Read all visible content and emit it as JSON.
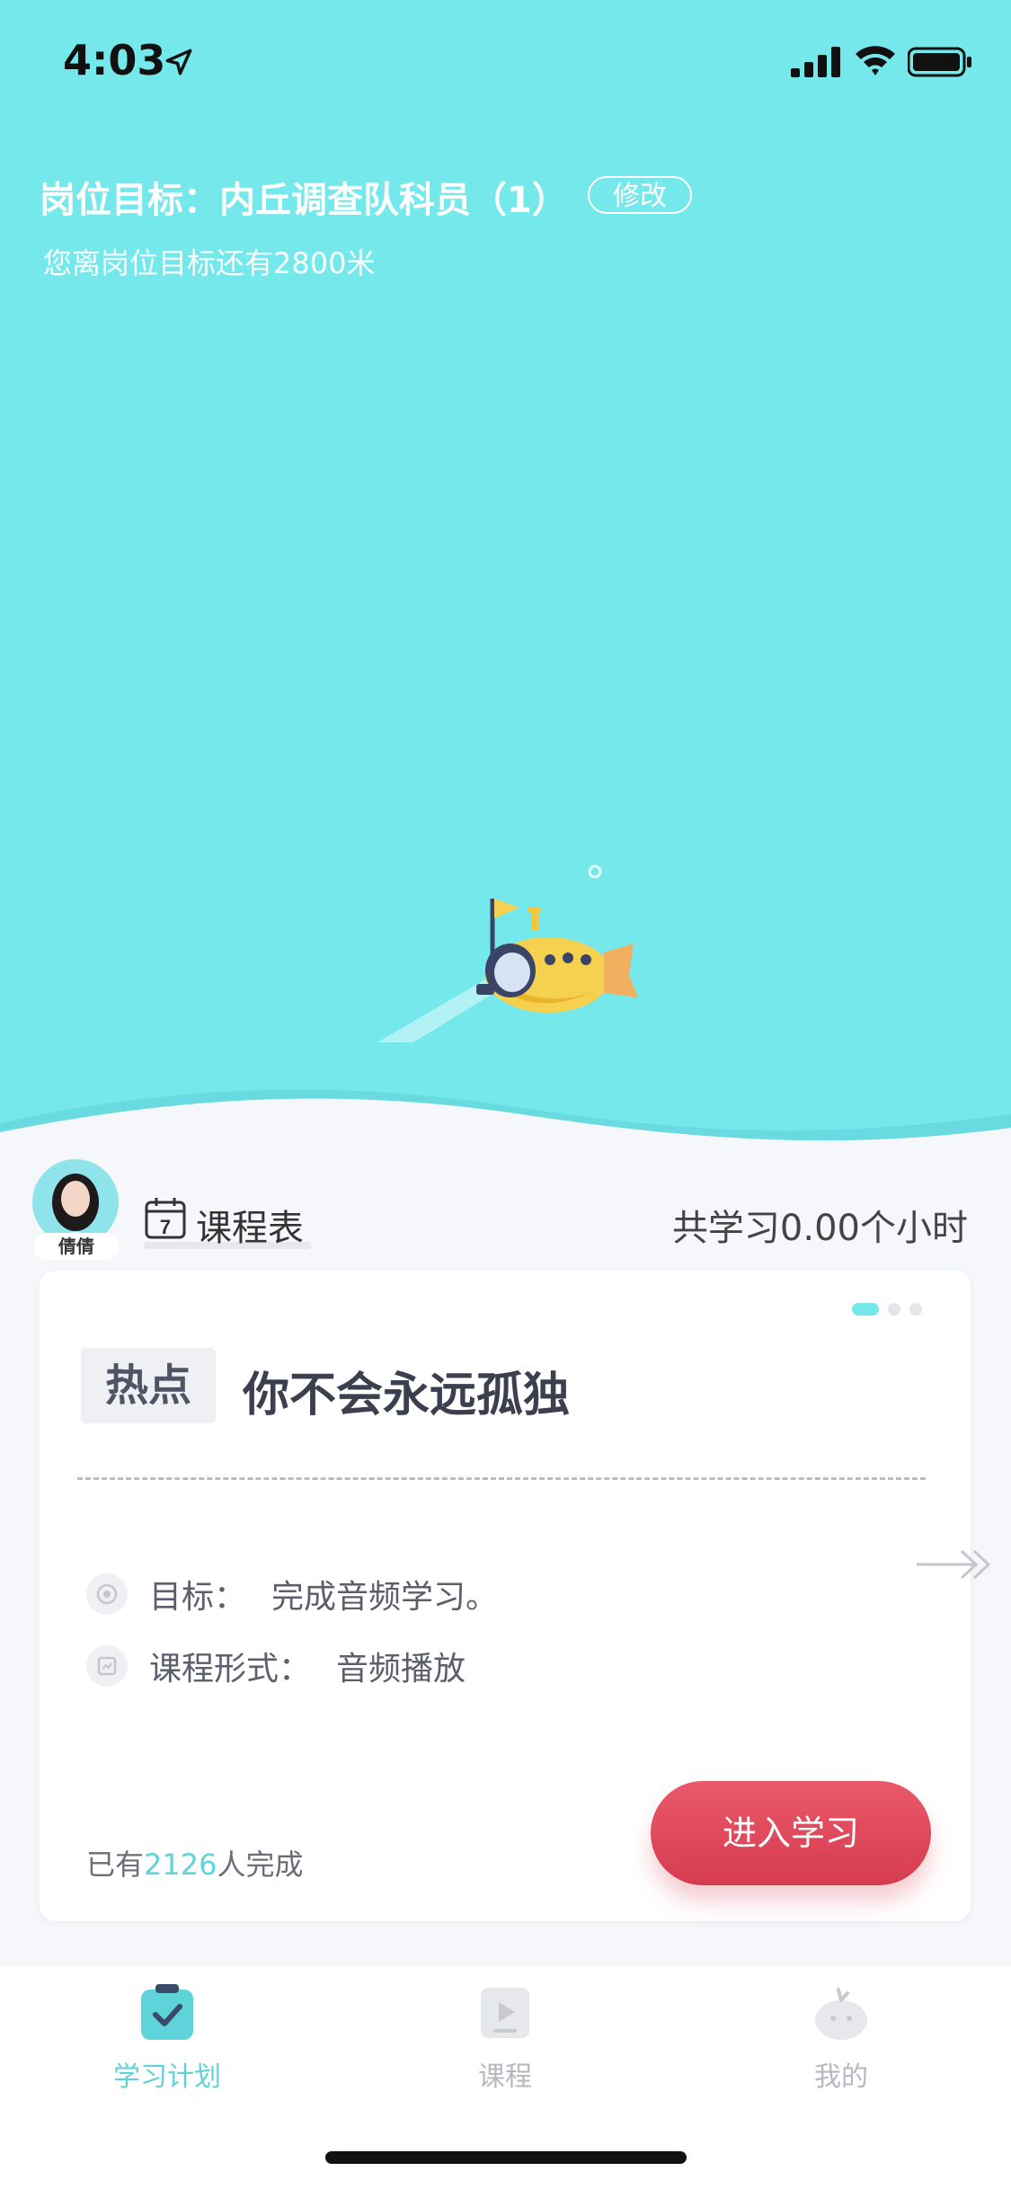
{
  "status_bar": {
    "time": "4:03"
  },
  "goal": {
    "title": "岗位目标：内丘调查队科员（1）",
    "modify_label": "修改",
    "distance_text": "您离岗位目标还有2800米"
  },
  "header": {
    "teacher_name": "倩倩",
    "schedule_day": "7",
    "schedule_label": "课程表",
    "total_hours": "共学习0.00个小时"
  },
  "card": {
    "tag": "热点",
    "title": "你不会永远孤独",
    "goal_key": "目标：",
    "goal_value": "完成音频学习。",
    "format_key": "课程形式：",
    "format_value": "音频播放",
    "completed_prefix": "已有",
    "completed_count": "2126",
    "completed_suffix": "人完成",
    "enter_button": "进入学习",
    "carousel_pages": 3,
    "carousel_active": 1
  },
  "tabs": [
    {
      "label": "学习计划",
      "icon": "clipboard-check-icon",
      "active": true
    },
    {
      "label": "课程",
      "icon": "video-play-icon",
      "active": false
    },
    {
      "label": "我的",
      "icon": "profile-icon",
      "active": false
    }
  ],
  "colors": {
    "sky": "#75e8ec",
    "accent": "#5fd3da",
    "primary_button": "#d63c4f",
    "inactive_tab": "#b5b8bf"
  }
}
